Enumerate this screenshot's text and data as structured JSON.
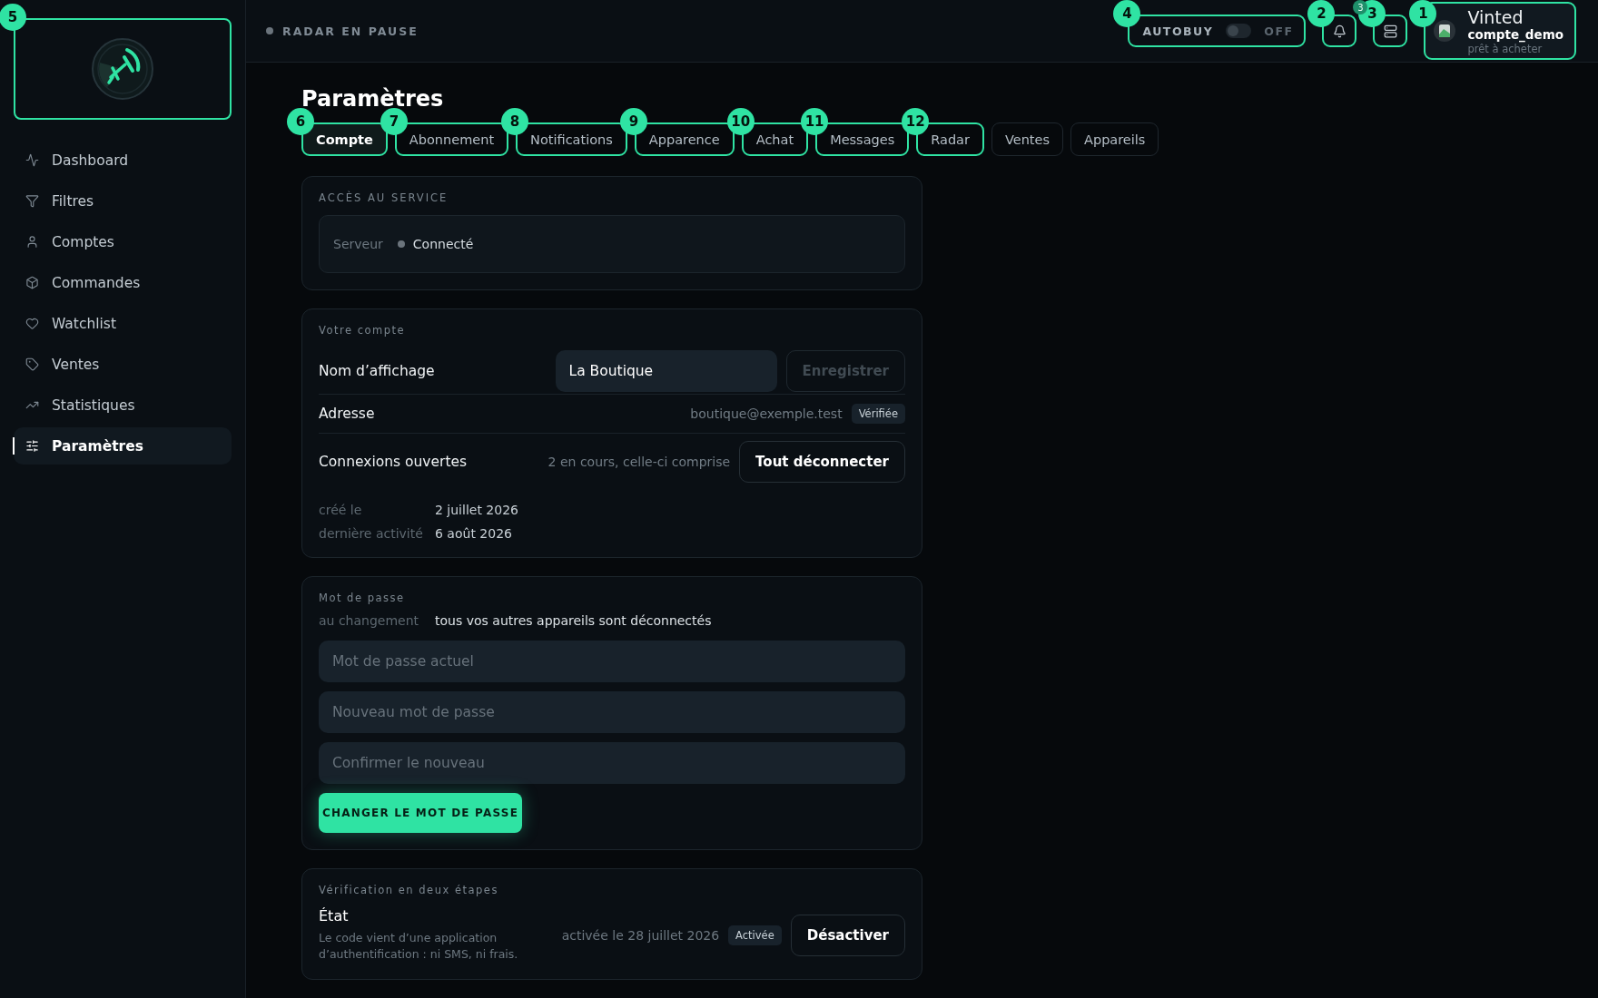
{
  "sidebar": {
    "logo_marker": "5",
    "items": [
      {
        "label": "Dashboard",
        "selected": false
      },
      {
        "label": "Filtres",
        "selected": false
      },
      {
        "label": "Comptes",
        "selected": false
      },
      {
        "label": "Commandes",
        "selected": false
      },
      {
        "label": "Watchlist",
        "selected": false
      },
      {
        "label": "Ventes",
        "selected": false
      },
      {
        "label": "Statistiques",
        "selected": false
      },
      {
        "label": "Paramètres",
        "selected": true
      }
    ]
  },
  "topbar": {
    "status": "RADAR EN PAUSE",
    "autobuy": {
      "label": "AUTOBUY",
      "on": false,
      "state_text": "OFF",
      "marker": "4"
    },
    "notifications": {
      "count": "3",
      "marker": "2"
    },
    "wallet": {
      "marker": "3"
    },
    "account": {
      "platform": "Vinted",
      "name": "compte_demo",
      "status": "prêt à acheter",
      "marker": "1"
    }
  },
  "page": {
    "title": "Paramètres",
    "tabs": [
      {
        "label": "Compte",
        "selected": true,
        "marker": "6"
      },
      {
        "label": "Abonnement",
        "selected": false,
        "marker": "7"
      },
      {
        "label": "Notifications",
        "selected": false,
        "marker": "8"
      },
      {
        "label": "Apparence",
        "selected": false,
        "marker": "9"
      },
      {
        "label": "Achat",
        "selected": false,
        "marker": "10"
      },
      {
        "label": "Messages",
        "selected": false,
        "marker": "11"
      },
      {
        "label": "Radar",
        "selected": false,
        "marker": "12"
      },
      {
        "label": "Ventes",
        "selected": false
      },
      {
        "label": "Appareils",
        "selected": false
      }
    ]
  },
  "service": {
    "heading": "ACCÈS AU SERVICE",
    "label": "Serveur",
    "status": "Connecté"
  },
  "account": {
    "heading": "Votre compte",
    "display_name": {
      "label": "Nom d’affichage",
      "value": "La Boutique",
      "save": "Enregistrer",
      "save_disabled": true
    },
    "address": {
      "label": "Adresse",
      "value": "boutique@exemple.test",
      "badge": "Vérifiée"
    },
    "sessions": {
      "label": "Connexions ouvertes",
      "info": "2 en cours, celle-ci comprise",
      "button": "Tout déconnecter"
    },
    "meta": [
      {
        "label": "créé le",
        "value": "2 juillet 2026"
      },
      {
        "label": "dernière activité",
        "value": "6 août 2026"
      }
    ]
  },
  "password": {
    "heading": "Mot de passe",
    "note_label": "au changement",
    "note": "tous vos autres appareils sont déconnectés",
    "fields": [
      {
        "placeholder": "Mot de passe actuel"
      },
      {
        "placeholder": "Nouveau mot de passe"
      },
      {
        "placeholder": "Confirmer le nouveau"
      }
    ],
    "button": "CHANGER LE MOT DE PASSE"
  },
  "two_factor": {
    "heading": "Vérification en deux étapes",
    "label": "État",
    "description": "Le code vient d’une application d’authentification : ni SMS, ni frais.",
    "info": "activée le 28 juillet 2026",
    "badge": "Activée",
    "button": "Désactiver"
  }
}
